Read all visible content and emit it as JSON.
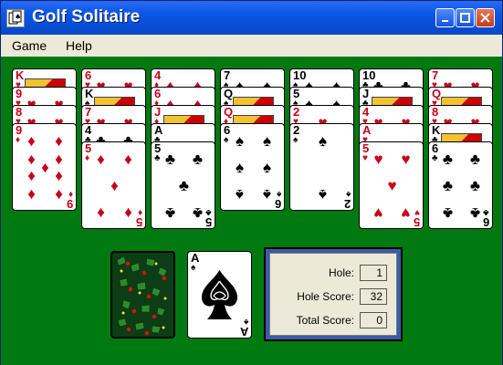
{
  "window": {
    "title": "Golf Solitaire"
  },
  "menu": {
    "items": [
      "Game",
      "Help"
    ]
  },
  "tableau": [
    [
      "K♥",
      "9♥",
      "8♥",
      "9♦"
    ],
    [
      "6♥",
      "K♠",
      "7♥",
      "4♣",
      "5♦"
    ],
    [
      "4♦",
      "6♦",
      "J♦",
      "A♣",
      "5♣"
    ],
    [
      "7♠",
      "Q♠",
      "Q♦",
      "6♠"
    ],
    [
      "10♠",
      "5♠",
      "2♥",
      "2♠"
    ],
    [
      "10♣",
      "J♣",
      "4♥",
      "A♥",
      "5♥"
    ],
    [
      "7♥",
      "Q♥",
      "8♥",
      "K♣",
      "6♣"
    ]
  ],
  "waste": {
    "rank": "A",
    "suit": "♠"
  },
  "score": {
    "hole_label": "Hole:",
    "hole": "1",
    "hole_score_label": "Hole Score:",
    "hole_score": "32",
    "total_label": "Total Score:",
    "total": "0"
  },
  "colors": {
    "felt": "#007a10",
    "red_suit": "#c8001a",
    "title_bar": "#0747c9"
  }
}
